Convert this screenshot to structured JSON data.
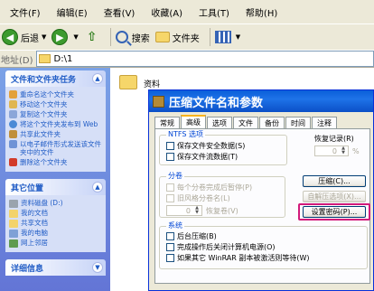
{
  "menu": [
    "文件(F)",
    "编辑(E)",
    "查看(V)",
    "收藏(A)",
    "工具(T)",
    "帮助(H)"
  ],
  "toolbar": {
    "back_label": "后退",
    "search_label": "搜索",
    "folders_label": "文件夹"
  },
  "address": {
    "label": "地址(D)",
    "value": "D:\\1"
  },
  "left_pane": {
    "tasks_title": "文件和文件夹任务",
    "tasks": [
      "重命名这个文件夹",
      "移动这个文件夹",
      "复制这个文件夹",
      "将这个文件夹发布到 Web",
      "共享此文件夹",
      "以电子邮件形式发送该文件夹中的文件",
      "删除这个文件夹"
    ],
    "places_title": "其它位置",
    "places": [
      "资料磁盘 (D:)",
      "我的文档",
      "共享文档",
      "我的电脑",
      "网上邻居"
    ],
    "details_title": "详细信息"
  },
  "main": {
    "folder_name": "资料"
  },
  "dialog": {
    "title": "压缩文件名和参数",
    "tabs": [
      "常规",
      "高级",
      "选项",
      "文件",
      "备份",
      "时间",
      "注释"
    ],
    "active_tab": "高级",
    "ntfs": {
      "label": "NTFS 选项",
      "options": [
        "保存文件安全数据(S)",
        "保存文件流数据(T)"
      ]
    },
    "recovery": {
      "label": "恢复记录(R)",
      "value": "0",
      "unit": "%"
    },
    "compress_button": "压缩(C)...",
    "volumes": {
      "label": "分卷",
      "options": [
        "每个分卷完成后暂停(P)",
        "旧风格分卷名(L)"
      ],
      "spin_value": "0",
      "recovery_volumes_label": "恢复卷(V)"
    },
    "sfx_button": "自解压选项(X)...",
    "password_button": "设置密码(P)...",
    "system": {
      "label": "系统",
      "options": [
        "后台压缩(B)",
        "完成操作后关闭计算机电源(O)",
        "如果其它 WinRAR 副本被激活则等待(W)"
      ]
    }
  }
}
